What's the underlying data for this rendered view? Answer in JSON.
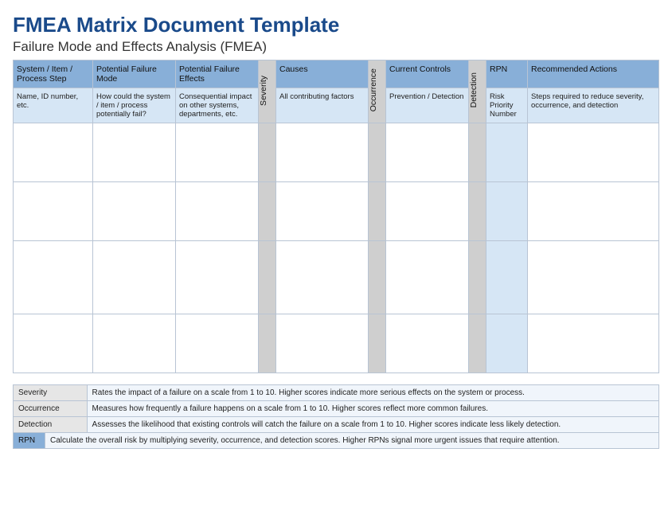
{
  "header": {
    "title": "FMEA Matrix Document Template",
    "subtitle": "Failure Mode and Effects Analysis (FMEA)"
  },
  "columns": {
    "system": {
      "label": "System / Item / Process Step",
      "desc": "Name, ID number, etc."
    },
    "mode": {
      "label": "Potential Failure Mode",
      "desc": "How could the system / item / process potentially fail?"
    },
    "effects": {
      "label": "Potential Failure Effects",
      "desc": "Consequential impact on other systems, departments, etc."
    },
    "severity": {
      "label": "Severity"
    },
    "causes": {
      "label": "Causes",
      "desc": "All contributing factors"
    },
    "occurrence": {
      "label": "Occurrence"
    },
    "controls": {
      "label": "Current Controls",
      "desc": "Prevention / Detection"
    },
    "detection": {
      "label": "Detection"
    },
    "rpn": {
      "label": "RPN",
      "desc": "Risk Priority Number"
    },
    "actions": {
      "label": "Recommended Actions",
      "desc": "Steps required to reduce severity, occurrence, and detection"
    }
  },
  "data_row_count": 4,
  "legend": {
    "severity": {
      "key": "Severity",
      "text": "Rates the impact of a failure on a scale from 1 to 10. Higher scores indicate more serious effects on the system or process."
    },
    "occurrence": {
      "key": "Occurrence",
      "text": "Measures how frequently a failure happens on a scale from 1 to 10. Higher scores reflect more common failures."
    },
    "detection": {
      "key": "Detection",
      "text": "Assesses the likelihood that existing controls will catch the failure on a scale from 1 to 10. Higher scores indicate less likely detection."
    },
    "rpn": {
      "key": "RPN",
      "text": "Calculate the overall risk by multiplying severity, occurrence, and detection scores. Higher RPNs signal more urgent issues that require attention."
    }
  }
}
